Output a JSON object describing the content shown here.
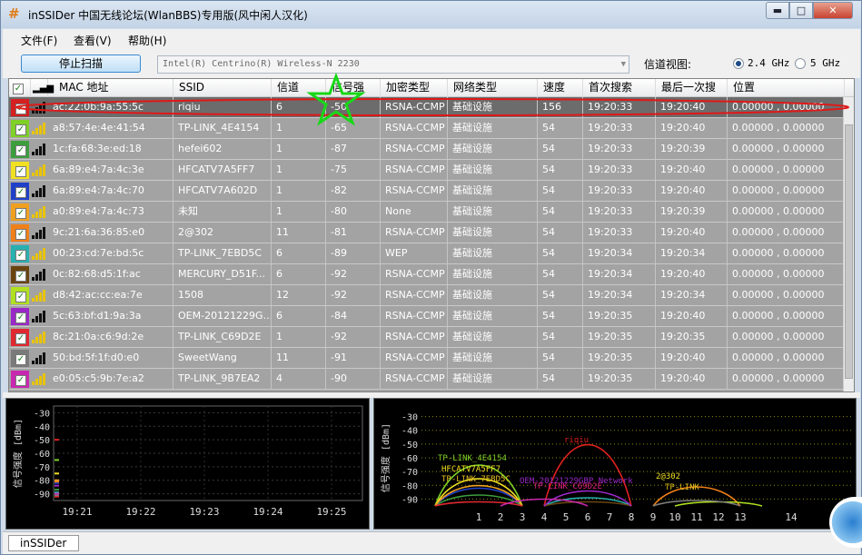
{
  "window": {
    "title": "inSSIDer 中国无线论坛(WlanBBS)专用版(风中闲人汉化)",
    "app_icon": "hash-app-icon",
    "min": "▬",
    "max": "□",
    "close": "✕"
  },
  "menu": [
    {
      "label": "文件(F)"
    },
    {
      "label": "查看(V)"
    },
    {
      "label": "帮助(H)"
    }
  ],
  "toolbar": {
    "stop_label": "停止扫描",
    "adapter": "Intel(R) Centrino(R) Wireless-N 2230",
    "channel_view_label": "信道视图:",
    "band_24": "2.4 GHz",
    "band_5": "5 GHz",
    "selected_band": "2.4 GHz"
  },
  "columns": [
    "MAC 地址",
    "SSID",
    "信道",
    "信号强",
    "加密类型",
    "网络类型",
    "速度",
    "首次搜索",
    "最后一次搜",
    "位置"
  ],
  "rows": [
    {
      "color": "#d42020",
      "mac": "ac:22:0b:9a:55:5c",
      "ssid": "riqiu",
      "channel": "6",
      "rssi": "-50",
      "enc": "RSNA-CCMP",
      "net": "基础设施",
      "speed": "156",
      "first": "19:20:33",
      "last": "19:20:40",
      "loc": "0.00000 , 0.00000",
      "selected": true
    },
    {
      "color": "#7fd027",
      "mac": "a8:57:4e:4e:41:54",
      "ssid": "TP-LINK_4E4154",
      "channel": "1",
      "rssi": "-65",
      "enc": "RSNA-CCMP",
      "net": "基础设施",
      "speed": "54",
      "first": "19:20:33",
      "last": "19:20:40",
      "loc": "0.00000 , 0.00000"
    },
    {
      "color": "#3d9e3d",
      "mac": "1c:fa:68:3e:ed:18",
      "ssid": "hefei602",
      "channel": "1",
      "rssi": "-87",
      "enc": "RSNA-CCMP",
      "net": "基础设施",
      "speed": "54",
      "first": "19:20:33",
      "last": "19:20:39",
      "loc": "0.00000 , 0.00000"
    },
    {
      "color": "#f0e020",
      "mac": "6a:89:e4:7a:4c:3e",
      "ssid": "HFCATV7A5FF7",
      "channel": "1",
      "rssi": "-75",
      "enc": "RSNA-CCMP",
      "net": "基础设施",
      "speed": "54",
      "first": "19:20:33",
      "last": "19:20:40",
      "loc": "0.00000 , 0.00000"
    },
    {
      "color": "#2040c8",
      "mac": "6a:89:e4:7a:4c:70",
      "ssid": "HFCATV7A602D",
      "channel": "1",
      "rssi": "-82",
      "enc": "RSNA-CCMP",
      "net": "基础设施",
      "speed": "54",
      "first": "19:20:33",
      "last": "19:20:40",
      "loc": "0.00000 , 0.00000"
    },
    {
      "color": "#f0a020",
      "mac": "a0:89:e4:7a:4c:73",
      "ssid": "未知",
      "channel": "1",
      "rssi": "-80",
      "enc": "None",
      "net": "基础设施",
      "speed": "54",
      "first": "19:20:33",
      "last": "19:20:39",
      "loc": "0.00000 , 0.00000"
    },
    {
      "color": "#f08018",
      "mac": "9c:21:6a:36:85:e0",
      "ssid": "2@302",
      "channel": "11",
      "rssi": "-81",
      "enc": "RSNA-CCMP",
      "net": "基础设施",
      "speed": "54",
      "first": "19:20:33",
      "last": "19:20:40",
      "loc": "0.00000 , 0.00000"
    },
    {
      "color": "#28b0b0",
      "mac": "00:23:cd:7e:bd:5c",
      "ssid": "TP-LINK_7EBD5C",
      "channel": "6",
      "rssi": "-89",
      "enc": "WEP",
      "net": "基础设施",
      "speed": "54",
      "first": "19:20:34",
      "last": "19:20:34",
      "loc": "0.00000 , 0.00000"
    },
    {
      "color": "#6a4410",
      "mac": "0c:82:68:d5:1f:ac",
      "ssid": "MERCURY_D51F...",
      "channel": "6",
      "rssi": "-92",
      "enc": "RSNA-CCMP",
      "net": "基础设施",
      "speed": "54",
      "first": "19:20:34",
      "last": "19:20:40",
      "loc": "0.00000 , 0.00000"
    },
    {
      "color": "#b0e020",
      "mac": "d8:42:ac:cc:ea:7e",
      "ssid": "1508",
      "channel": "12",
      "rssi": "-92",
      "enc": "RSNA-CCMP",
      "net": "基础设施",
      "speed": "54",
      "first": "19:20:34",
      "last": "19:20:34",
      "loc": "0.00000 , 0.00000"
    },
    {
      "color": "#9a28c8",
      "mac": "5c:63:bf:d1:9a:3a",
      "ssid": "OEM-20121229G...",
      "channel": "6",
      "rssi": "-84",
      "enc": "RSNA-CCMP",
      "net": "基础设施",
      "speed": "54",
      "first": "19:20:35",
      "last": "19:20:40",
      "loc": "0.00000 , 0.00000"
    },
    {
      "color": "#e02830",
      "mac": "8c:21:0a:c6:9d:2e",
      "ssid": "TP-LINK_C69D2E",
      "channel": "1",
      "rssi": "-92",
      "enc": "RSNA-CCMP",
      "net": "基础设施",
      "speed": "54",
      "first": "19:20:35",
      "last": "19:20:35",
      "loc": "0.00000 , 0.00000"
    },
    {
      "color": "#7a7a7a",
      "mac": "50:bd:5f:1f:d0:e0",
      "ssid": "SweetWang",
      "channel": "11",
      "rssi": "-91",
      "enc": "RSNA-CCMP",
      "net": "基础设施",
      "speed": "54",
      "first": "19:20:35",
      "last": "19:20:40",
      "loc": "0.00000 , 0.00000"
    },
    {
      "color": "#c828b0",
      "mac": "e0:05:c5:9b:7e:a2",
      "ssid": "TP-LINK_9B7EA2",
      "channel": "4",
      "rssi": "-90",
      "enc": "RSNA-CCMP",
      "net": "基础设施",
      "speed": "54",
      "first": "19:20:35",
      "last": "19:20:40",
      "loc": "0.00000 , 0.00000"
    }
  ],
  "time_graph": {
    "ylabel": "信号强度 [dBm]",
    "y_ticks": [
      "-30",
      "-40",
      "-50",
      "-60",
      "-70",
      "-80",
      "-90"
    ],
    "x_ticks": [
      "19:21",
      "19:22",
      "19:23",
      "19:24",
      "19:25"
    ]
  },
  "channel_graph": {
    "ylabel": "信号强度 [dBm]",
    "y_ticks": [
      "-30",
      "-40",
      "-50",
      "-60",
      "-70",
      "-80",
      "-90"
    ],
    "x_ticks": [
      "1",
      "2",
      "3",
      "4",
      "5",
      "6",
      "7",
      "8",
      "9",
      "10",
      "11",
      "12",
      "13",
      "14"
    ],
    "labels": [
      {
        "text": "riqiu",
        "color": "#e02020"
      },
      {
        "text": "TP-LINK_4E4154",
        "color": "#7fd027"
      },
      {
        "text": "HFCATV7A5FF7",
        "color": "#f0e020"
      },
      {
        "text": "TP-LINK_7EBD5C",
        "color": "#e8c020"
      },
      {
        "text": "OEM-20121229GBP Network",
        "color": "#9a28c8"
      },
      {
        "text": "TP-LINK_C69D2E",
        "color": "#e02080"
      },
      {
        "text": "2@302",
        "color": "#f0e020"
      },
      {
        "text": "TP-LINK",
        "color": "#e0c020"
      }
    ]
  },
  "status": {
    "tab": "inSSIDer"
  },
  "chart_data": [
    {
      "type": "line",
      "title": "",
      "xlabel": "",
      "ylabel": "信号强度 [dBm]",
      "ylim": [
        -95,
        -25
      ],
      "x_ticks": [
        "19:21",
        "19:22",
        "19:23",
        "19:24",
        "19:25"
      ],
      "series": []
    },
    {
      "type": "area",
      "title": "",
      "xlabel": "",
      "ylabel": "信号强度 [dBm]",
      "ylim": [
        -95,
        -25
      ],
      "x": [
        1,
        2,
        3,
        4,
        5,
        6,
        7,
        8,
        9,
        10,
        11,
        12,
        13,
        14
      ],
      "series": [
        {
          "name": "riqiu",
          "channel": 6,
          "value": -50,
          "color": "#e02020"
        },
        {
          "name": "TP-LINK_4E4154",
          "channel": 1,
          "value": -65,
          "color": "#7fd027"
        },
        {
          "name": "hefei602",
          "channel": 1,
          "value": -87,
          "color": "#3d9e3d"
        },
        {
          "name": "HFCATV7A5FF7",
          "channel": 1,
          "value": -75,
          "color": "#f0e020"
        },
        {
          "name": "HFCATV7A602D",
          "channel": 1,
          "value": -82,
          "color": "#2040c8"
        },
        {
          "name": "未知",
          "channel": 1,
          "value": -80,
          "color": "#f0a020"
        },
        {
          "name": "2@302",
          "channel": 11,
          "value": -81,
          "color": "#f08018"
        },
        {
          "name": "TP-LINK_7EBD5C",
          "channel": 6,
          "value": -89,
          "color": "#28b0b0"
        },
        {
          "name": "MERCURY_D51F...",
          "channel": 6,
          "value": -92,
          "color": "#6a4410"
        },
        {
          "name": "1508",
          "channel": 12,
          "value": -92,
          "color": "#b0e020"
        },
        {
          "name": "OEM-20121229G...",
          "channel": 6,
          "value": -84,
          "color": "#9a28c8"
        },
        {
          "name": "TP-LINK_C69D2E",
          "channel": 1,
          "value": -92,
          "color": "#e02830"
        },
        {
          "name": "SweetWang",
          "channel": 11,
          "value": -91,
          "color": "#7a7a7a"
        },
        {
          "name": "TP-LINK_9B7EA2",
          "channel": 4,
          "value": -90,
          "color": "#c828b0"
        }
      ]
    }
  ]
}
